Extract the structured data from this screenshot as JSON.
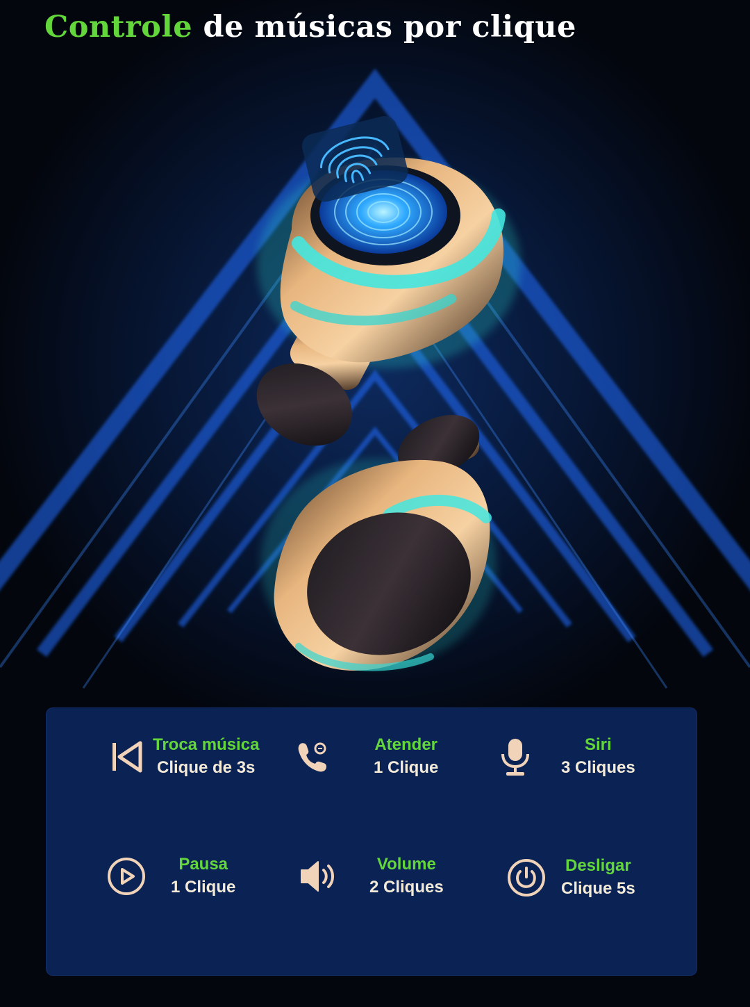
{
  "title": {
    "accent": "Controle",
    "rest": "de músicas por clique"
  },
  "controls": [
    {
      "label": "Troca música",
      "value": "Clique de 3s",
      "icon": "skip-previous-icon"
    },
    {
      "label": "Atender",
      "value": "1 Clique",
      "icon": "phone-call-icon"
    },
    {
      "label": "Siri",
      "value": "3 Cliques",
      "icon": "microphone-icon"
    },
    {
      "label": "Pausa",
      "value": "1 Clique",
      "icon": "play-pause-icon"
    },
    {
      "label": "Volume",
      "value": "2 Cliques",
      "icon": "speaker-volume-icon"
    },
    {
      "label": "Desligar",
      "value": "Clique 5s",
      "icon": "power-icon"
    }
  ],
  "colors": {
    "accent": "#63d63b",
    "panel": "#0b2254",
    "background": "#04070f",
    "icon": "#f0d3b8",
    "glow": "#3fe0d6"
  }
}
